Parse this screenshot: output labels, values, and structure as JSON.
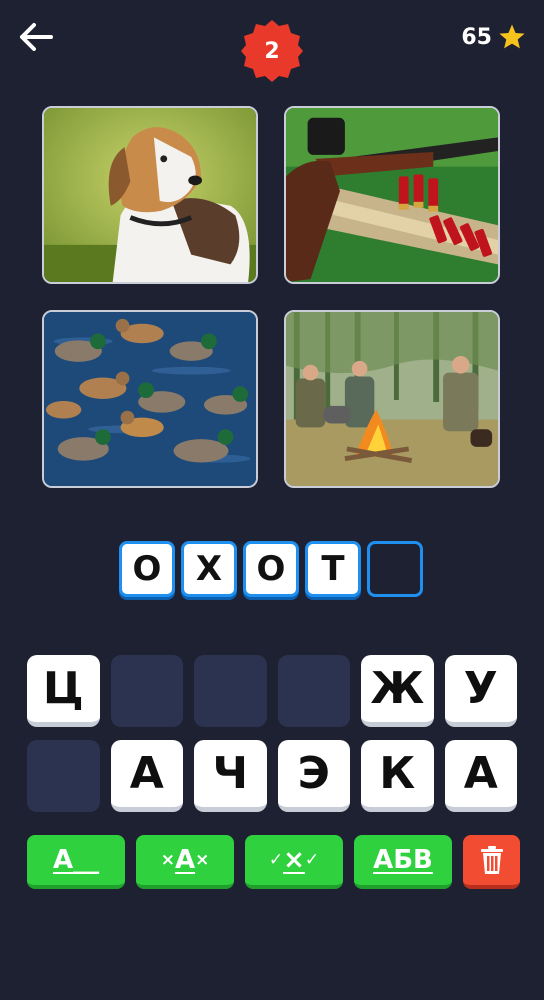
{
  "header": {
    "back_icon": "arrow-left-icon",
    "level": "2",
    "coins": "65",
    "coin_icon": "star-icon"
  },
  "pictures": [
    {
      "name": "dog",
      "icon": "dog-photo"
    },
    {
      "name": "shotgun",
      "icon": "shotgun-photo"
    },
    {
      "name": "ducks",
      "icon": "ducks-photo"
    },
    {
      "name": "hunters-campfire",
      "icon": "campfire-photo"
    }
  ],
  "answer": {
    "slots": [
      "О",
      "Х",
      "О",
      "Т",
      ""
    ]
  },
  "letters": {
    "row1": [
      "Ц",
      "",
      "",
      "",
      "Ж",
      "У"
    ],
    "row2": [
      "",
      "А",
      "Ч",
      "Э",
      "К",
      "А"
    ]
  },
  "hints": {
    "reveal_first": {
      "letter": "А",
      "rest": "__"
    },
    "remove_letters": {
      "a": "×",
      "b": "А",
      "c": "×"
    },
    "check_letters": {
      "a": "✓",
      "b": "×",
      "c": "✓"
    },
    "show_word": "АБВ",
    "delete_icon": "trash-icon"
  },
  "colors": {
    "background": "#1d2132",
    "accent_blue": "#1f8ff0",
    "badge_red": "#e8392a",
    "hint_green": "#2fd13f",
    "delete_red": "#f24c33",
    "star_yellow": "#f6c21c"
  }
}
